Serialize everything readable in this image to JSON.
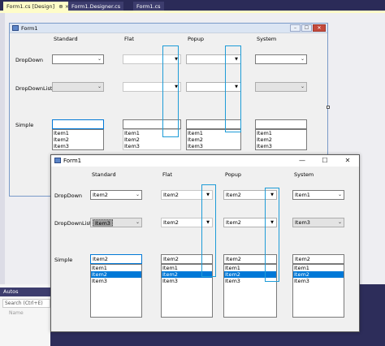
{
  "tabs": [
    {
      "label": "Form1.cs [Design]",
      "icons": "⊕ ×",
      "active": true
    },
    {
      "label": "Form1.Designer.cs",
      "active": false
    },
    {
      "label": "Form1.cs",
      "active": false
    }
  ],
  "design_form": {
    "title": "Form1",
    "columns": [
      "Standard",
      "Flat",
      "Popup",
      "System"
    ],
    "rows": [
      "DropDown",
      "DropDownList",
      "Simple"
    ],
    "simple_items": [
      "Item1",
      "Item2",
      "Item3"
    ]
  },
  "run_form": {
    "title": "Form1",
    "window_buttons": {
      "minimize": "—",
      "maximize": "☐",
      "close": "✕"
    },
    "columns": [
      "Standard",
      "Flat",
      "Popup",
      "System"
    ],
    "rows": [
      "DropDown",
      "DropDownList",
      "Simple"
    ],
    "dropdown_values": [
      "Item2",
      "Item2",
      "Item2",
      "Item1"
    ],
    "dropdownlist_values": [
      "Item3",
      "Item2",
      "Item2",
      "Item3"
    ],
    "simple_text": [
      "Item2",
      "Item2",
      "Item2",
      "Item2"
    ],
    "simple_items": [
      "Item1",
      "Item2",
      "Item3"
    ],
    "selected_item": "Item2"
  },
  "autos": {
    "title": "Autos",
    "search_placeholder": "Search (Ctrl+E)",
    "column_name": "Name"
  },
  "colors": {
    "highlight": "#1e9cd7",
    "selection": "#0078d7",
    "vs_chrome": "#2d2d5a"
  }
}
